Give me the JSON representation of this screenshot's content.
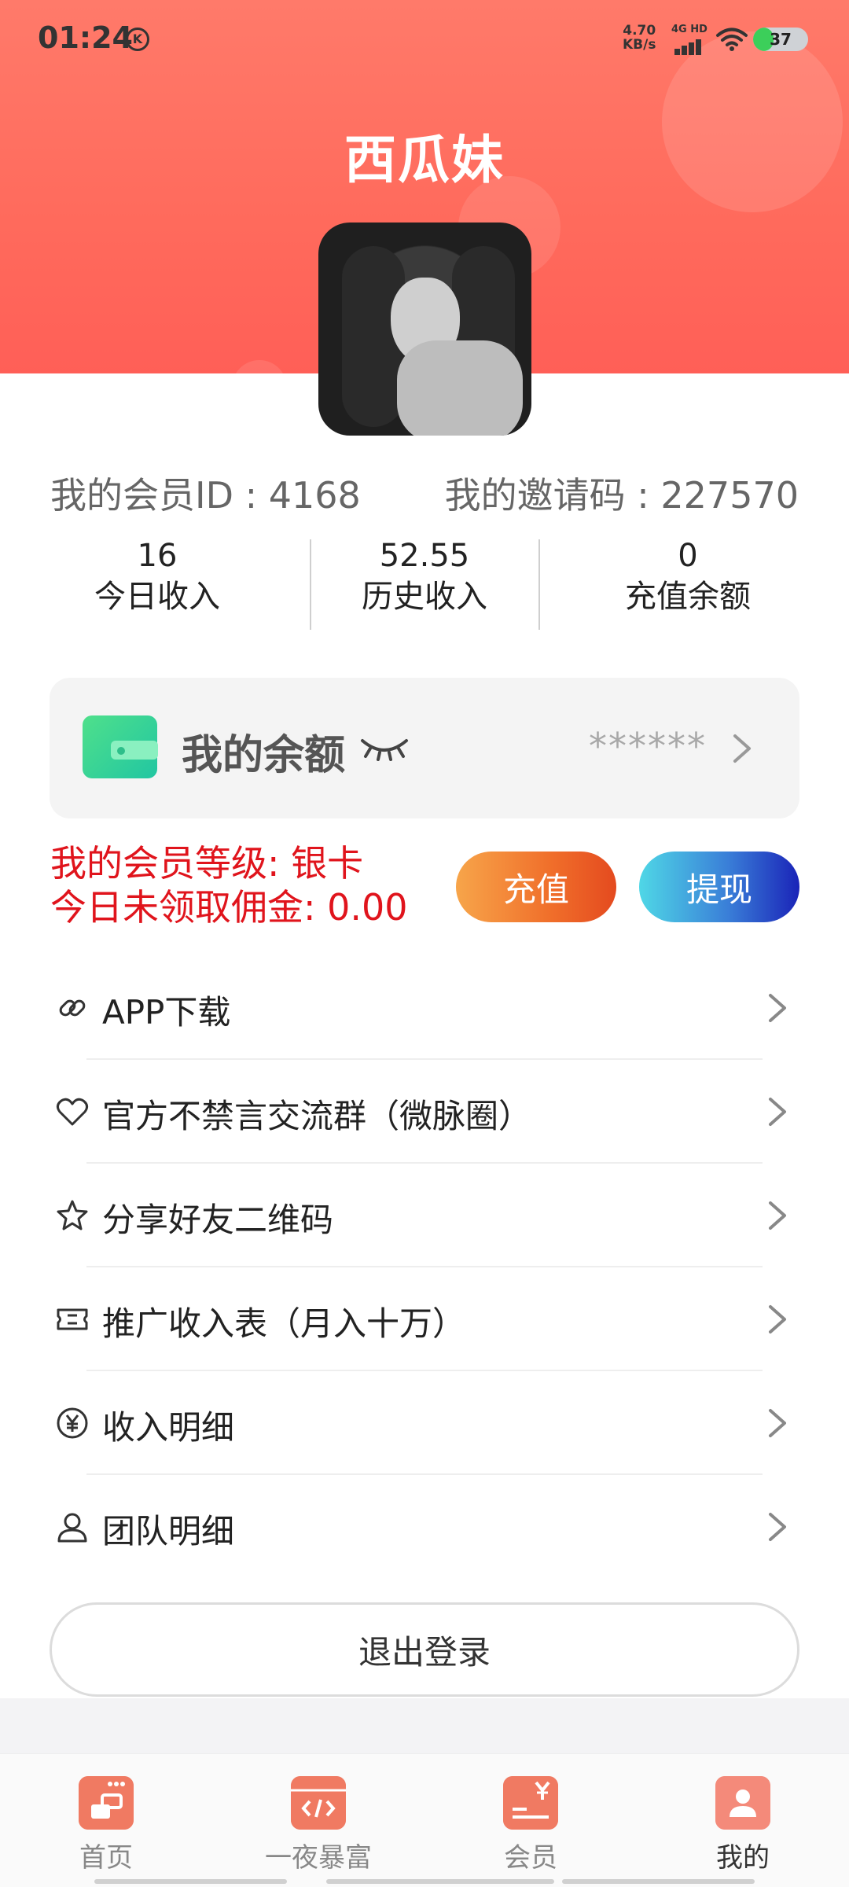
{
  "status_bar": {
    "time": "01:24",
    "k_badge": "K",
    "net_speed_value": "4.70",
    "net_speed_unit": "KB/s",
    "network_label": "4G HD",
    "battery": "37",
    "battery_level": 0.37
  },
  "profile": {
    "nickname": "西瓜妹",
    "member_id_text": "我的会员ID : 4168",
    "invite_code_text": "我的邀请码 : 227570"
  },
  "stats": [
    {
      "value": "16",
      "label": "今日收入"
    },
    {
      "value": "52.55",
      "label": "历史收入"
    },
    {
      "value": "0",
      "label": "充值余额"
    }
  ],
  "balance_card": {
    "title": "我的余额",
    "masked_value": "******"
  },
  "level": {
    "grade_text": "我的会员等级: 银卡",
    "commission_text": "今日未领取佣金: 0.00"
  },
  "buttons": {
    "recharge": "充值",
    "withdraw": "提现",
    "logout": "退出登录"
  },
  "menu": [
    {
      "label": "APP下载",
      "icon": "link-icon"
    },
    {
      "label": "官方不禁言交流群（微脉圈）",
      "icon": "heart-icon"
    },
    {
      "label": "分享好友二维码",
      "icon": "star-icon"
    },
    {
      "label": "推广收入表（月入十万）",
      "icon": "ticket-icon"
    },
    {
      "label": "收入明细",
      "icon": "yen-circle-icon"
    },
    {
      "label": "团队明细",
      "icon": "user-icon"
    }
  ],
  "bottom_nav": [
    {
      "label": "首页",
      "icon": "home-icon"
    },
    {
      "label": "一夜暴富",
      "icon": "code-icon"
    },
    {
      "label": "会员",
      "icon": "yen-card-icon"
    },
    {
      "label": "我的",
      "icon": "profile-icon",
      "active": true
    }
  ],
  "colors": {
    "header": "#ff6a5c",
    "level_text": "#e0141c",
    "recharge_gradient_start": "#f7a54a",
    "withdraw_gradient_end": "#1a24b8"
  }
}
